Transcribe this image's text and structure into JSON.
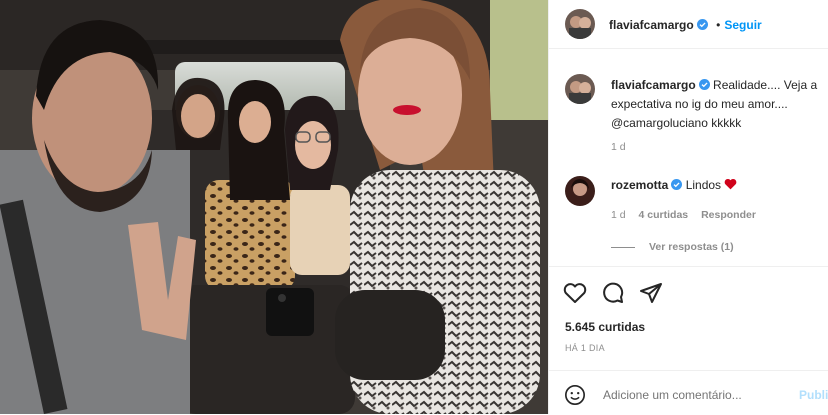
{
  "header": {
    "username": "flaviafcamargo",
    "follow_label": "Seguir"
  },
  "caption": {
    "username": "flaviafcamargo",
    "text_line1": "Realidade.... Veja a",
    "text_line2": "expectativa no ig do meu amor....",
    "text_line3": "@camargoluciano kkkkk",
    "time": "1 d"
  },
  "comment": {
    "username": "rozemotta",
    "text": "Lindos",
    "time": "1 d",
    "likes": "4 curtidas",
    "reply_label": "Responder",
    "view_replies": "Ver respostas (1)"
  },
  "actions": {
    "likes_count": "5.645 curtidas",
    "posted_ago": "HÁ 1 DIA"
  },
  "composer": {
    "placeholder": "Adicione um comentário...",
    "publish_label": "Publi"
  },
  "colors": {
    "accent": "#0095f6",
    "verified": "#3897f0",
    "heart": "#d0021b"
  },
  "icons": [
    "heart-icon",
    "comment-icon",
    "share-icon",
    "emoji-icon",
    "verified-badge-icon"
  ]
}
